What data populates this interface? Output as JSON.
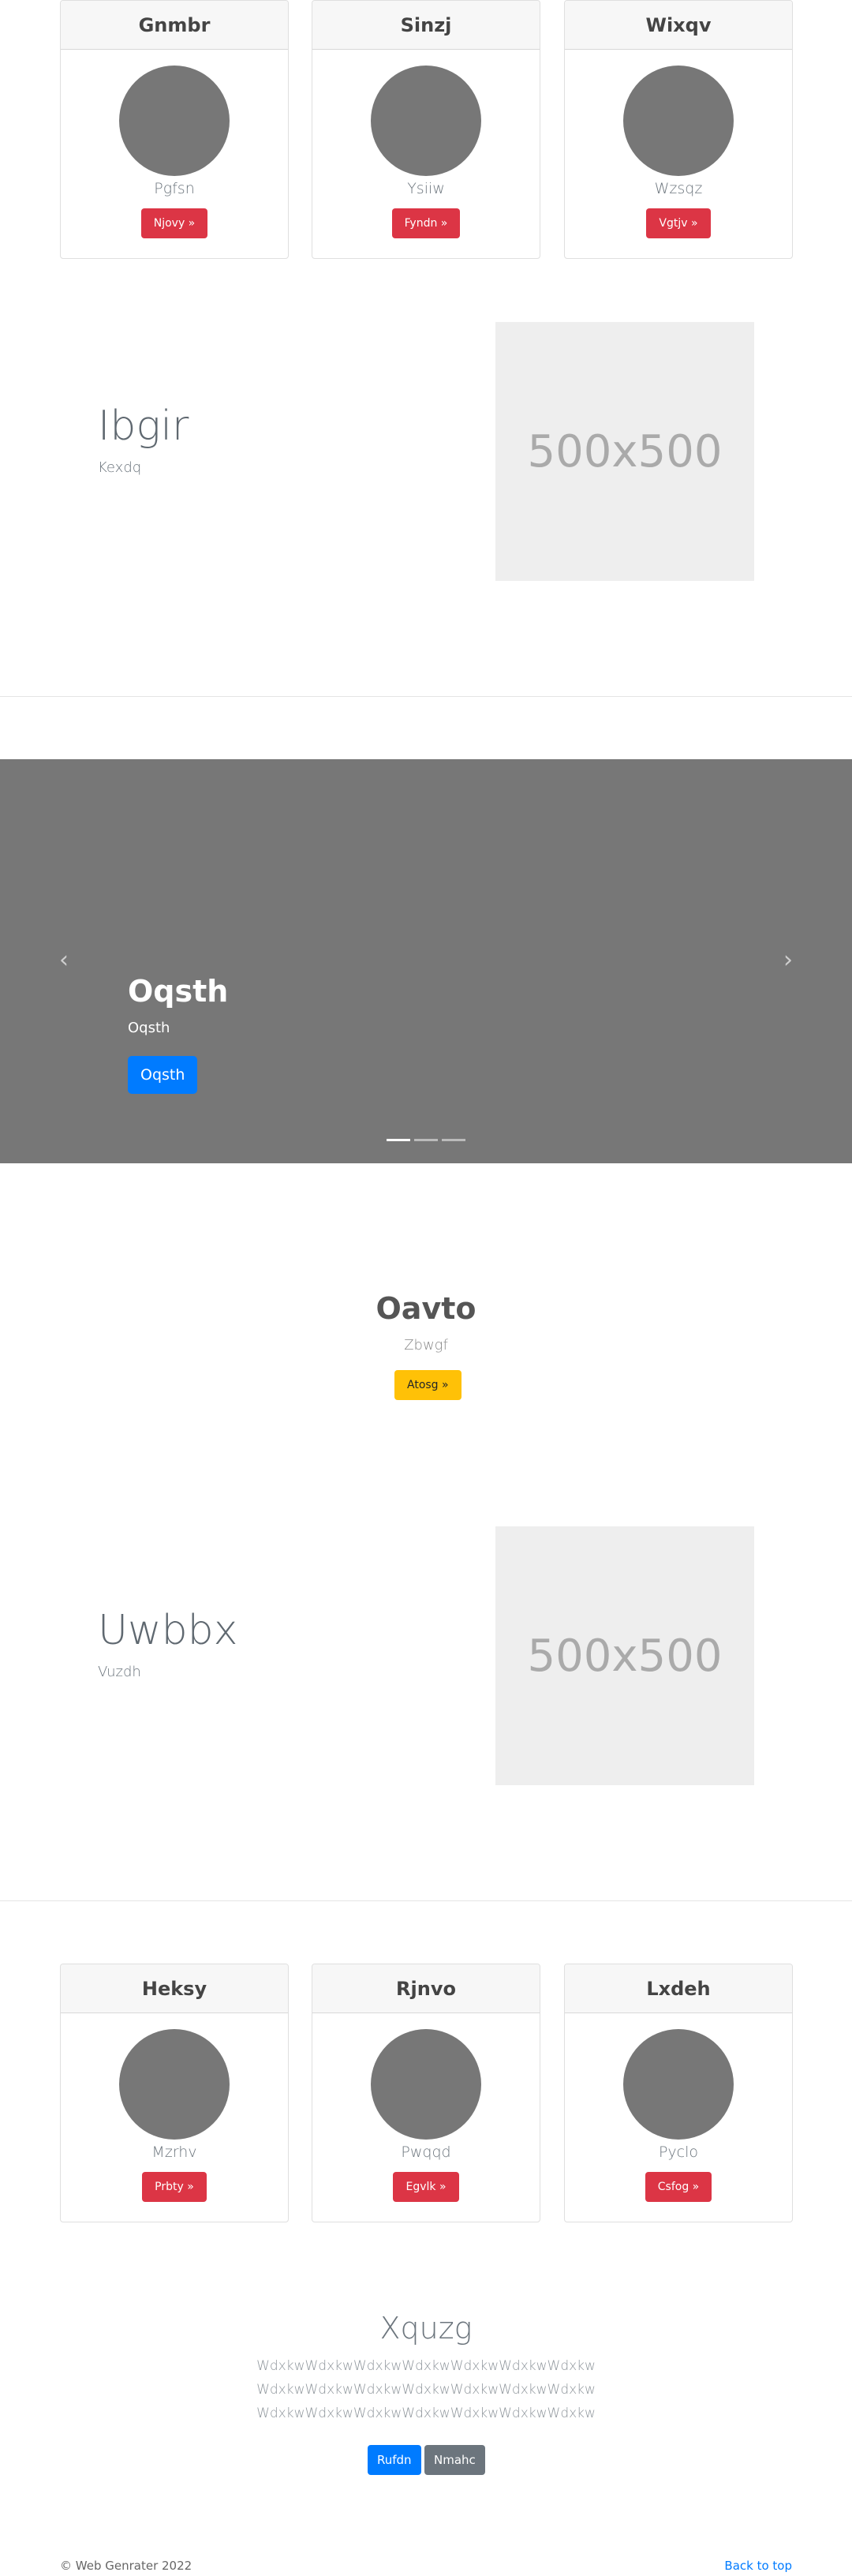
{
  "cards_top": [
    {
      "title": "Gnmbr",
      "subtitle": "Pgfsn",
      "button": "Njovy »"
    },
    {
      "title": "Sinzj",
      "subtitle": "Ysiiw",
      "button": "Fyndn »"
    },
    {
      "title": "Wixqv",
      "subtitle": "Wzsqz",
      "button": "Vgtjv »"
    }
  ],
  "feature1": {
    "title": "Ibgir",
    "subtitle": "Kexdq",
    "image_label": "500x500"
  },
  "carousel": {
    "title": "Oqsth",
    "subtitle": "Oqsth",
    "button": "Oqsth",
    "prev_icon": "‹",
    "next_icon": "›"
  },
  "center": {
    "title": "Oavto",
    "subtitle": "Zbwgf",
    "button": "Atosg »"
  },
  "feature2": {
    "title": "Uwbbx",
    "subtitle": "Vuzdh",
    "image_label": "500x500"
  },
  "cards_bottom": [
    {
      "title": "Heksy",
      "subtitle": "Mzrhv",
      "button": "Prbty »"
    },
    {
      "title": "Rjnvo",
      "subtitle": "Pwqqd",
      "button": "Egvlk »"
    },
    {
      "title": "Lxdeh",
      "subtitle": "Pyclo",
      "button": "Csfog »"
    }
  ],
  "text_section": {
    "title": "Xquzg",
    "lines": [
      "WdxkwWdxkwWdxkwWdxkwWdxkwWdxkwWdxkw",
      "WdxkwWdxkwWdxkwWdxkwWdxkwWdxkwWdxkw",
      "WdxkwWdxkwWdxkwWdxkwWdxkwWdxkwWdxkw"
    ],
    "primary_button": "Rufdn",
    "secondary_button": "Nmahc"
  },
  "footer": {
    "copyright": "© Web Genrater 2022",
    "back_to_top": "Back to top"
  },
  "colors": {
    "card_button": "#dc3545",
    "primary": "#007bff",
    "warning": "#ffc107",
    "secondary": "#6c757d",
    "carousel_bg": "#777777",
    "placeholder_bg": "#eeeeee"
  }
}
